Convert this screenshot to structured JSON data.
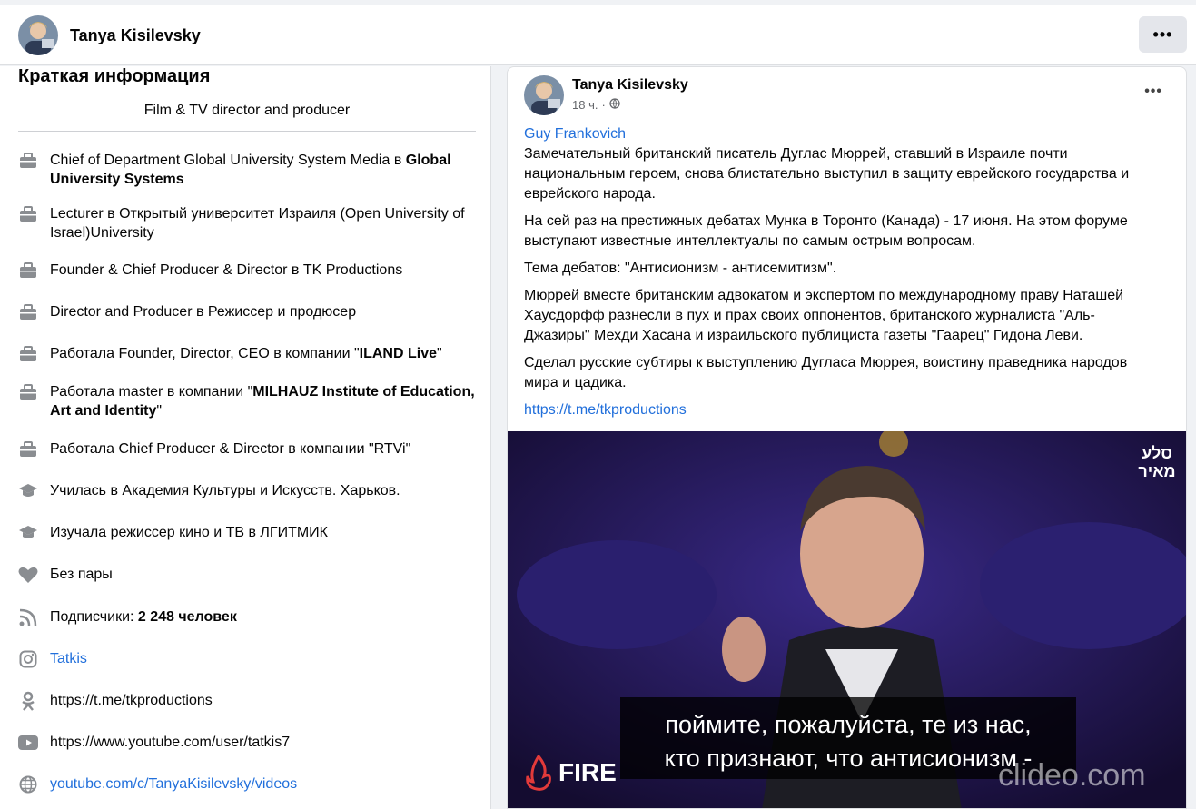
{
  "header": {
    "name": "Tanya Kisilevsky",
    "more_label": "•••"
  },
  "intro": {
    "title": "Краткая информация",
    "bio": "Film & TV director and producer",
    "items": [
      {
        "icon": "briefcase-icon",
        "text": "Chief of Department Global University System Media в ",
        "bold": "Global University Systems",
        "after": ""
      },
      {
        "icon": "briefcase-icon",
        "text": "Lecturer в Открытый университет Израиля (Open University of Israel)University",
        "bold": "",
        "after": ""
      },
      {
        "icon": "briefcase-icon",
        "text": "Founder & Chief Producer & Director в TK Productions",
        "bold": "",
        "after": ""
      },
      {
        "icon": "briefcase-icon",
        "text": "Director and Producer в Режиссер и продюсер",
        "bold": "",
        "after": ""
      },
      {
        "icon": "briefcase-icon",
        "text": "Работала Founder, Director, CEO в компании \"",
        "bold": "ILAND Live",
        "after": "\""
      },
      {
        "icon": "briefcase-icon",
        "text": "Работала master в компании \"",
        "bold": "MILHAUZ Institute of Education, Art and Identity",
        "after": "\""
      },
      {
        "icon": "briefcase-icon",
        "text": "Работала Chief Producer & Director в компании \"RTVi\"",
        "bold": "",
        "after": ""
      },
      {
        "icon": "graduation-cap-icon",
        "text": "Училась в Академия Культуры и Искусств. Харьков.",
        "bold": "",
        "after": ""
      },
      {
        "icon": "graduation-cap-icon",
        "text": "Изучала режиссер кино и ТВ в ЛГИТМИК",
        "bold": "",
        "after": ""
      },
      {
        "icon": "heart-icon",
        "text": "Без пары",
        "bold": "",
        "after": ""
      },
      {
        "icon": "rss-icon",
        "text": "Подписчики: ",
        "bold": "2 248 человек",
        "after": ""
      },
      {
        "icon": "instagram-icon",
        "link": "Tatkis"
      },
      {
        "icon": "odnoklassniki-icon",
        "text": "https://t.me/tkproductions",
        "bold": "",
        "after": ""
      },
      {
        "icon": "youtube-icon",
        "text": "https://www.youtube.com/user/tatkis7",
        "bold": "",
        "after": ""
      },
      {
        "icon": "globe-icon",
        "link": "youtube.com/c/TanyaKisilevsky/videos"
      }
    ]
  },
  "post": {
    "author": "Tanya Kisilevsky",
    "time": "18 ч.",
    "dot": "·",
    "more_label": "•••",
    "quoted_author": "Guy Frankovich",
    "paragraphs": [
      "Замечательный британский писатель Дуглас Мюррей, ставший в Израиле почти национальным героем, снова блистательно выступил в защиту еврейского государства и еврейского народа.",
      "На сей раз на престижных дебатах Мунка в Торонто (Канада) - 17 июня. На этом форуме выступают известные интеллектуалы по самым острым вопросам.",
      "Тема дебатов: \"Антисионизм - антисемитизм\".",
      "Мюррей вместе британским адвокатом и экспертом по международному праву Наташей Хаусдорфф разнесли в пух и прах своих оппонентов, британского журналиста \"Аль-Джазиры\" Мехди Хасана и израильского публициста газеты \"Гаарец\" Гидона Леви.",
      "Сделал русские субтиры к выступлению Дугласа Мюррея, воистину праведника народов мира и цадика."
    ],
    "link": "https://t.me/tkproductions",
    "video": {
      "subtitle_line1": "поймите, пожалуйста, те из нас,",
      "subtitle_line2": "кто признают, что антисионизм -",
      "fire_label": "FIRE",
      "watermark": "clideo.com",
      "corner_logo": "סלע מאיר"
    }
  }
}
